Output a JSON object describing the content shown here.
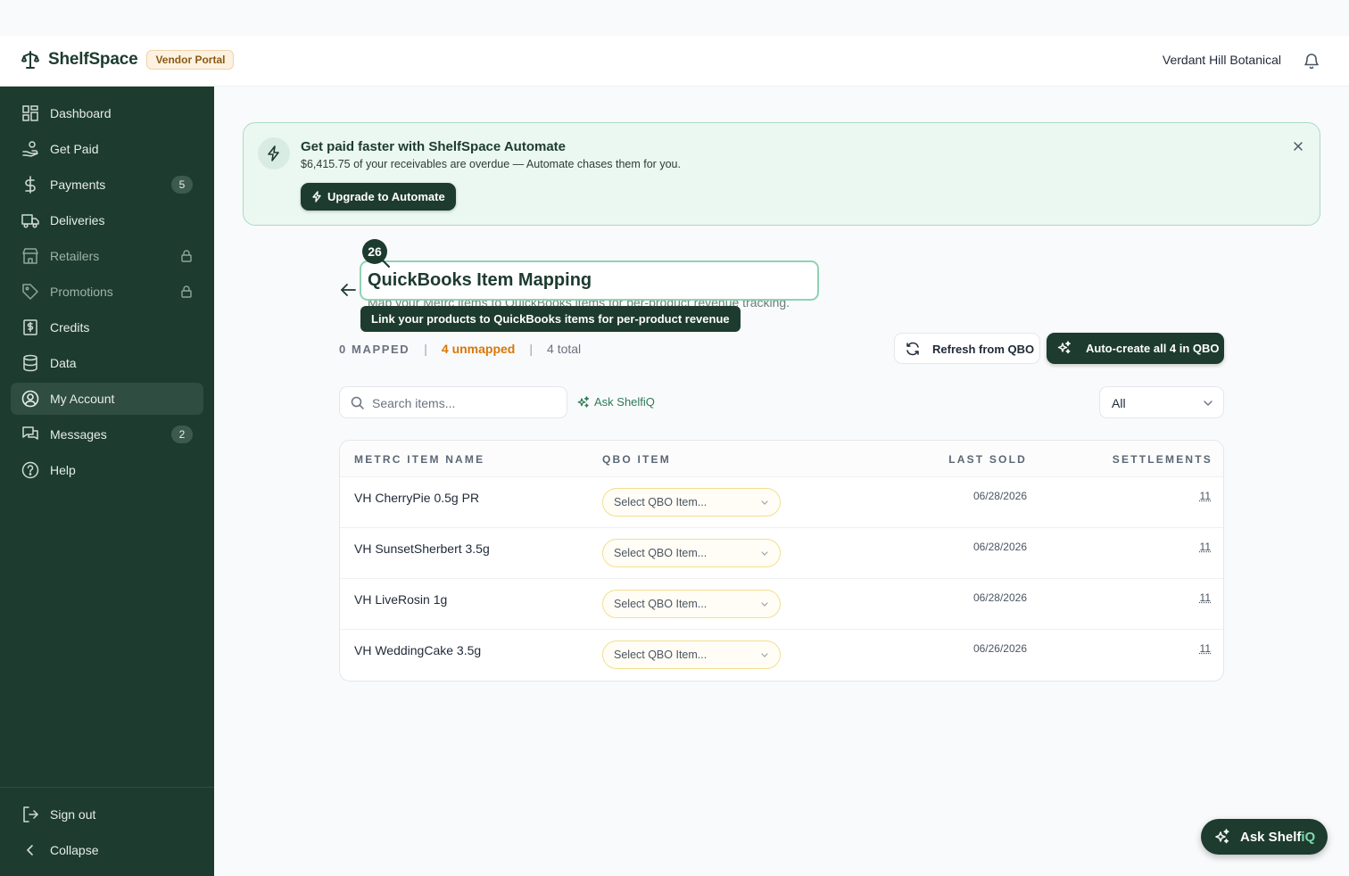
{
  "header": {
    "app_name": "ShelfSpace",
    "portal_badge": "Vendor Portal",
    "vendor_name": "Verdant Hill Botanical",
    "logo_icon": "scale-icon",
    "notification_icon": "bell-icon"
  },
  "sidebar": {
    "items": [
      {
        "label": "Dashboard",
        "icon": "grid-icon"
      },
      {
        "label": "Get Paid",
        "icon": "hand-coin-icon"
      },
      {
        "label": "Payments",
        "icon": "dollar-icon",
        "count": "5"
      },
      {
        "label": "Deliveries",
        "icon": "truck-icon"
      },
      {
        "label": "Retailers",
        "icon": "store-icon",
        "locked": true
      },
      {
        "label": "Promotions",
        "icon": "tag-icon",
        "locked": true
      },
      {
        "label": "Credits",
        "icon": "receipt-icon"
      },
      {
        "label": "Data",
        "icon": "database-icon"
      },
      {
        "label": "My Account",
        "icon": "user-circle-icon",
        "active": true
      },
      {
        "label": "Messages",
        "icon": "chat-icon",
        "count": "2"
      },
      {
        "label": "Help",
        "icon": "help-icon"
      }
    ],
    "footer": {
      "sign_out": "Sign out",
      "collapse": "Collapse"
    }
  },
  "promo": {
    "title": "Get paid faster with ShelfSpace Automate",
    "subtitle": "$6,415.75 of your receivables are overdue — Automate chases them for you.",
    "button": "Upgrade to Automate"
  },
  "page": {
    "title": "QuickBooks Item Mapping",
    "subtitle": "Map your Metrc items to QuickBooks items for per-product revenue tracking.",
    "step_number": "26",
    "tooltip": "Link your products to QuickBooks items for per-product revenue"
  },
  "stats": {
    "mapped": "0 MAPPED",
    "separator": "|",
    "unmapped": "4 unmapped",
    "total": "4 total"
  },
  "actions": {
    "refresh": "Refresh from QBO",
    "auto_create": "Auto-create all 4 in QBO"
  },
  "search": {
    "placeholder": "Search items...",
    "ask_label": "Ask ShelfiQ"
  },
  "filter": {
    "selected": "All"
  },
  "table": {
    "columns": [
      "METRC ITEM NAME",
      "QBO ITEM",
      "LAST SOLD",
      "SETTLEMENTS"
    ],
    "rows": [
      {
        "name": "VH CherryPie 0.5g PR",
        "qbo": "Select QBO Item...",
        "last_sold": "06/28/2026",
        "settlements": "11"
      },
      {
        "name": "VH SunsetSherbert 3.5g",
        "qbo": "Select QBO Item...",
        "last_sold": "06/28/2026",
        "settlements": "11"
      },
      {
        "name": "VH LiveRosin 1g",
        "qbo": "Select QBO Item...",
        "last_sold": "06/28/2026",
        "settlements": "11"
      },
      {
        "name": "VH WeddingCake 3.5g",
        "qbo": "Select QBO Item...",
        "last_sold": "06/26/2026",
        "settlements": "11"
      }
    ]
  },
  "fab": {
    "label_main": "Ask Shelf",
    "label_accent": "iQ"
  },
  "colors": {
    "brand_dark": "#1d3b2f",
    "accent_green": "#7fd8ac",
    "warning_orange": "#d97706",
    "promo_bg": "#ebf7f1"
  }
}
